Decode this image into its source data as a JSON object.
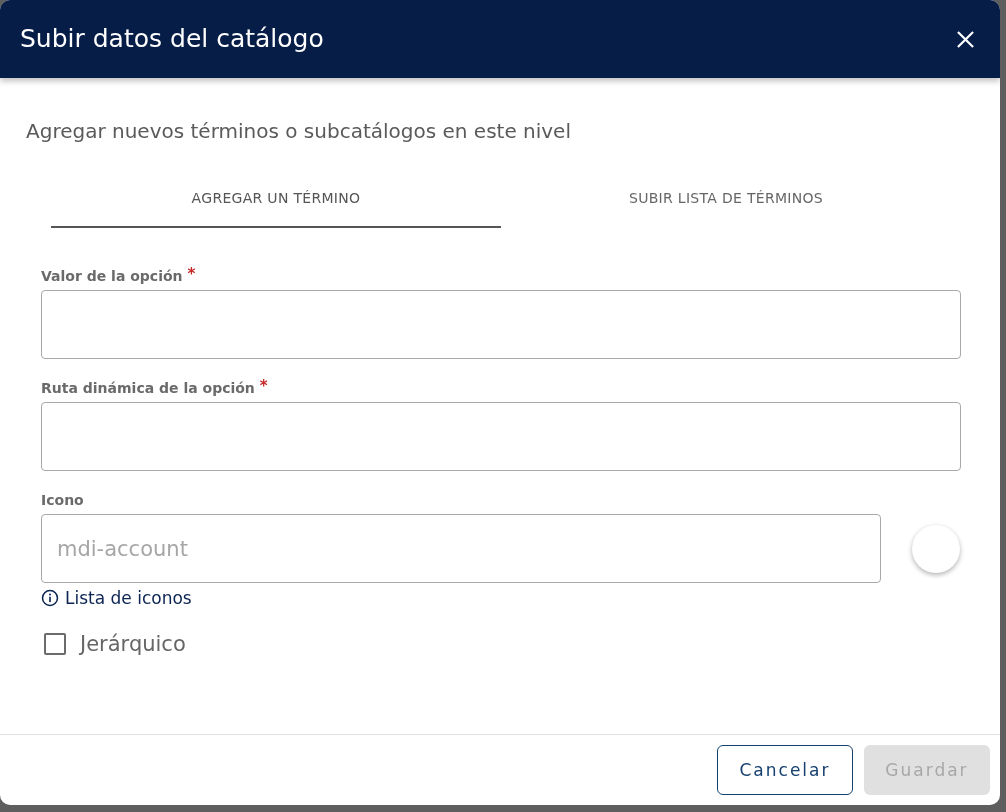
{
  "dialog": {
    "title": "Subir datos del catálogo",
    "subtitle": "Agregar nuevos términos o subcatálogos en este nivel"
  },
  "tabs": [
    {
      "label": "AGREGAR UN TÉRMINO",
      "selected": true
    },
    {
      "label": "SUBIR LISTA DE TÉRMINOS",
      "selected": false
    }
  ],
  "fields": [
    {
      "kind": "text",
      "label": "Valor de la opción",
      "required_mark": "*"
    },
    {
      "kind": "text",
      "label": "Ruta dinámica de la opción",
      "required_mark": "*"
    },
    {
      "kind": "icon",
      "label": "Icono",
      "placeholder": "mdi-account",
      "help_link": "Lista de iconos"
    }
  ],
  "checkbox": {
    "label": "Jerárquico",
    "checked": false
  },
  "buttons": [
    {
      "label": "Cancelar",
      "kind": "outlined",
      "disabled": false
    },
    {
      "label": "Guardar",
      "kind": "filled",
      "disabled": true
    }
  ]
}
